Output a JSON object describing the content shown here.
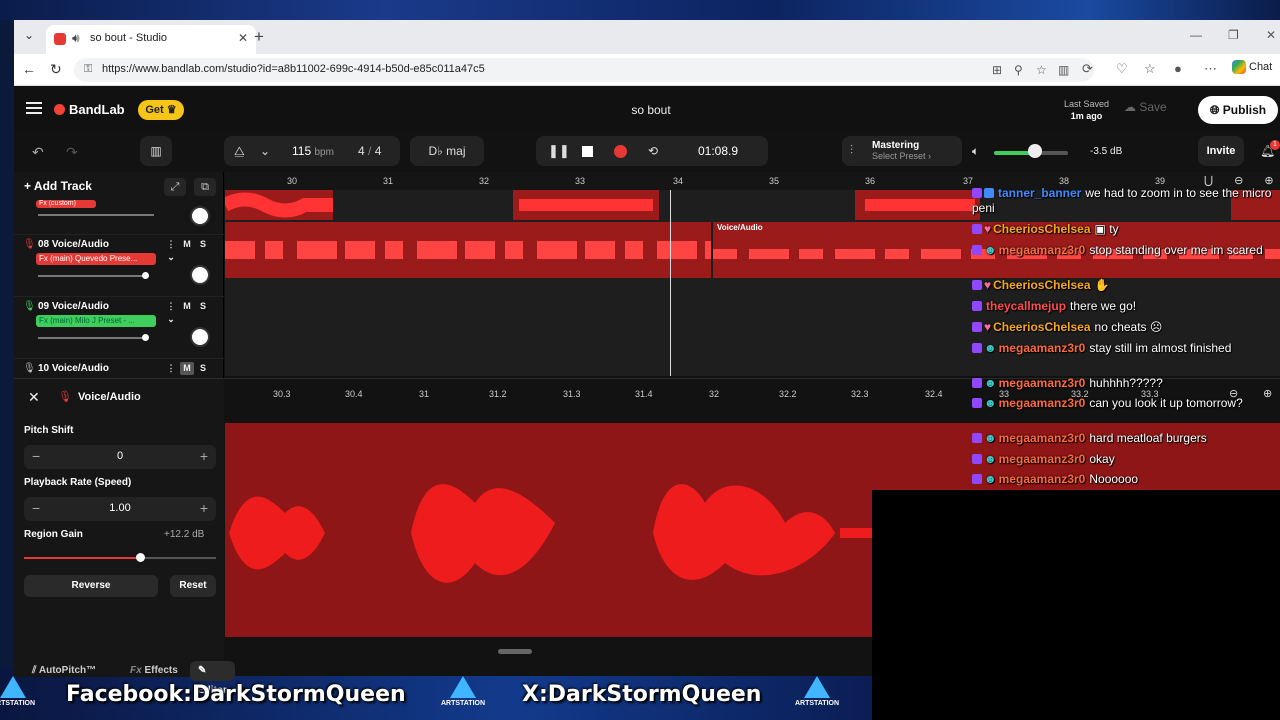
{
  "browser": {
    "tab_title": "so bout - Studio",
    "url": "https://www.bandlab.com/studio?id=a8b11002-699c-4914-b50d-e85c011a47c5",
    "chat_chip": "Chat"
  },
  "header": {
    "brand": "BandLab",
    "get_label": "Get",
    "project_title": "so bout",
    "last_saved_label": "Last Saved",
    "last_saved_value": "1m ago",
    "save_label": "Save",
    "publish_label": "Publish"
  },
  "toolbar": {
    "bpm": "115",
    "bpm_unit": "bpm",
    "time_sig_num": "4",
    "time_sig_sep": "/",
    "time_sig_den": "4",
    "key": "D♭ maj",
    "time": "01:08.9",
    "mastering_title": "Mastering",
    "mastering_sub": "Select Preset ›",
    "volume_db": "-3.5 dB",
    "volume_level": 0.55,
    "invite_label": "Invite",
    "notif_count": "1"
  },
  "tracklist": {
    "add_track": "Add Track",
    "prev_fx": "Fx (custom)",
    "tracks": [
      {
        "name": "08  Voice/Audio",
        "fx": "Fx (main) Quevedo Prese...",
        "fx_color": "#e53935",
        "mic_color": "#e53935"
      },
      {
        "name": "09  Voice/Audio",
        "fx": "Fx (main) Milo J Preset - ...",
        "fx_color": "#3fce5d",
        "mic_color": "#3fce5d"
      },
      {
        "name": "10  Voice/Audio",
        "fx": "",
        "fx_color": "",
        "mic_color": "#bbbbbb"
      }
    ],
    "mute": "M",
    "solo": "S"
  },
  "timeline": {
    "bars": [
      "30",
      "31",
      "32",
      "33",
      "34",
      "35",
      "36",
      "37",
      "38",
      "39"
    ],
    "region_label": "Voice/Audio"
  },
  "editor": {
    "title": "Voice/Audio",
    "pitch_label": "Pitch Shift",
    "pitch_value": "0",
    "rate_label": "Playback Rate (Speed)",
    "rate_value": "1.00",
    "gain_label": "Region Gain",
    "gain_value": "+12.2 dB",
    "reverse_label": "Reverse",
    "reset_label": "Reset",
    "ruler": [
      "30.3",
      "30.4",
      "31",
      "31.2",
      "31.3",
      "31.4",
      "32",
      "32.2",
      "32.3",
      "32.4",
      "33",
      "33.2",
      "33.3"
    ],
    "tabs": [
      "AutoPitch™",
      "Effects",
      "Editor"
    ],
    "fx_prefix": "Fx"
  },
  "chat": [
    {
      "user": "tanner_banner",
      "color": "#3e8bff",
      "text": "we had to zoom in to see the micro peni"
    },
    {
      "user": "CheeriosChelsea",
      "color": "#f5a623",
      "text": "ty"
    },
    {
      "user": "megaamanz3r0",
      "color": "#ff6a3d",
      "text": "stop standing over me im scared"
    },
    {
      "user": "CheeriosChelsea",
      "color": "#f5a623",
      "text": ""
    },
    {
      "user": "theycallmejup",
      "color": "#ff4d4d",
      "text": "there we go!"
    },
    {
      "user": "CheeriosChelsea",
      "color": "#f5a623",
      "text": "no cheats"
    },
    {
      "user": "megaamanz3r0",
      "color": "#ff6a3d",
      "text": "stay still im almost finished"
    },
    {
      "user": "megaamanz3r0",
      "color": "#ff6a3d",
      "text": "huhhhh?????"
    },
    {
      "user": "megaamanz3r0",
      "color": "#ff6a3d",
      "text": "can you look it up tomorrow?"
    },
    {
      "user": "megaamanz3r0",
      "color": "#ff6a3d",
      "text": "hard meatloaf burgers"
    },
    {
      "user": "megaamanz3r0",
      "color": "#ff6a3d",
      "text": "okay"
    },
    {
      "user": "megaamanz3r0",
      "color": "#ff6a3d",
      "text": "Noooooo"
    }
  ],
  "social": {
    "facebook": "Facebook:DarkStormQueen",
    "x": "X:DarkStormQueen",
    "artstation": "ARTSTATION"
  }
}
